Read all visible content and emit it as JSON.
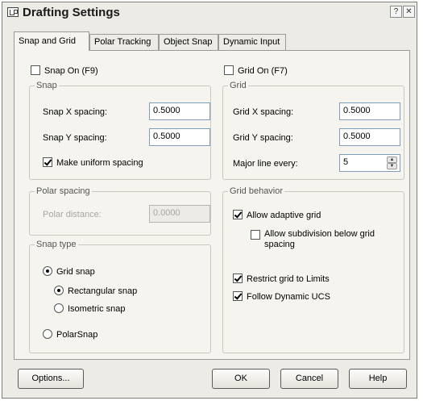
{
  "window": {
    "title": "Drafting Settings"
  },
  "titlebar": {
    "help_glyph": "?",
    "close_glyph": "✕"
  },
  "tabs": [
    {
      "label": "Snap and Grid",
      "active": true
    },
    {
      "label": "Polar Tracking",
      "active": false
    },
    {
      "label": "Object Snap",
      "active": false
    },
    {
      "label": "Dynamic Input",
      "active": false
    }
  ],
  "snap_on": {
    "label": "Snap On (F9)",
    "checked": false
  },
  "grid_on": {
    "label": "Grid On (F7)",
    "checked": false
  },
  "snap": {
    "title": "Snap",
    "x_label": "Snap X spacing:",
    "x_value": "0.5000",
    "y_label": "Snap Y spacing:",
    "y_value": "0.5000",
    "uniform_label": "Make uniform spacing",
    "uniform_checked": true
  },
  "grid": {
    "title": "Grid",
    "x_label": "Grid X spacing:",
    "x_value": "0.5000",
    "y_label": "Grid Y spacing:",
    "y_value": "0.5000",
    "major_label": "Major line every:",
    "major_value": "5"
  },
  "polar_spacing": {
    "title": "Polar spacing",
    "distance_label": "Polar distance:",
    "distance_value": "0.0000"
  },
  "snap_type": {
    "title": "Snap type",
    "grid_snap": {
      "label": "Grid snap",
      "selected": true
    },
    "rectangular": {
      "label": "Rectangular snap",
      "selected": true
    },
    "isometric": {
      "label": "Isometric snap",
      "selected": false
    },
    "polar": {
      "label": "PolarSnap",
      "selected": false
    }
  },
  "grid_behavior": {
    "title": "Grid behavior",
    "adaptive": {
      "label": "Allow adaptive grid",
      "checked": true
    },
    "subdivision": {
      "label_line1": "Allow subdivision below grid",
      "label_line2": "spacing",
      "checked": false
    },
    "limits": {
      "label": "Restrict grid to Limits",
      "checked": true
    },
    "dynamic_ucs": {
      "label": "Follow Dynamic UCS",
      "checked": true
    }
  },
  "buttons": {
    "options": "Options...",
    "ok": "OK",
    "cancel": "Cancel",
    "help": "Help"
  },
  "colors": {
    "dialog_bg": "#ecebe6",
    "panel_bg": "#f5f4ef",
    "input_border": "#7f9db9",
    "disabled_text": "#a6a6a6"
  }
}
